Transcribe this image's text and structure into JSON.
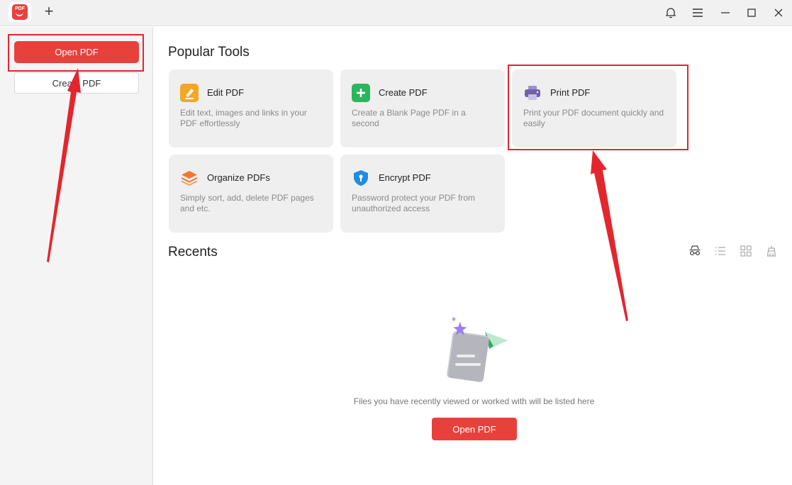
{
  "titlebar": {
    "logo_text": "PDF",
    "new_tab_symbol": "+",
    "icons": [
      "bell-icon",
      "menu-icon",
      "minimize-icon",
      "maximize-icon",
      "close-icon"
    ]
  },
  "sidebar": {
    "open_label": "Open PDF",
    "create_label": "Create PDF"
  },
  "popular": {
    "title": "Popular Tools",
    "tools": [
      {
        "title": "Edit PDF",
        "desc": "Edit text, images and links in your PDF effortlessly",
        "icon": "edit-pen-icon",
        "color": "#f5a623"
      },
      {
        "title": "Create PDF",
        "desc": "Create a Blank Page PDF in a second",
        "icon": "plus-icon",
        "color": "#2db55d"
      },
      {
        "title": "Print PDF",
        "desc": "Print your PDF document quickly and easily",
        "icon": "printer-icon",
        "color": "#7062a8"
      },
      {
        "title": "Organize PDFs",
        "desc": "Simply sort, add, delete PDF pages and etc.",
        "icon": "layers-icon",
        "color": "#f07a2b"
      },
      {
        "title": "Encrypt PDF",
        "desc": "Password protect your PDF from unauthorized access",
        "icon": "shield-lock-icon",
        "color": "#1f8de0"
      }
    ]
  },
  "recents": {
    "title": "Recents",
    "view_icons": [
      "incognito-icon",
      "list-view-icon",
      "grid-view-icon",
      "clear-history-icon"
    ],
    "empty_text": "Files you have recently viewed or worked with will be listed here",
    "open_label": "Open PDF"
  },
  "colors": {
    "accent": "#e8413c",
    "annotation": "#e3262d"
  }
}
